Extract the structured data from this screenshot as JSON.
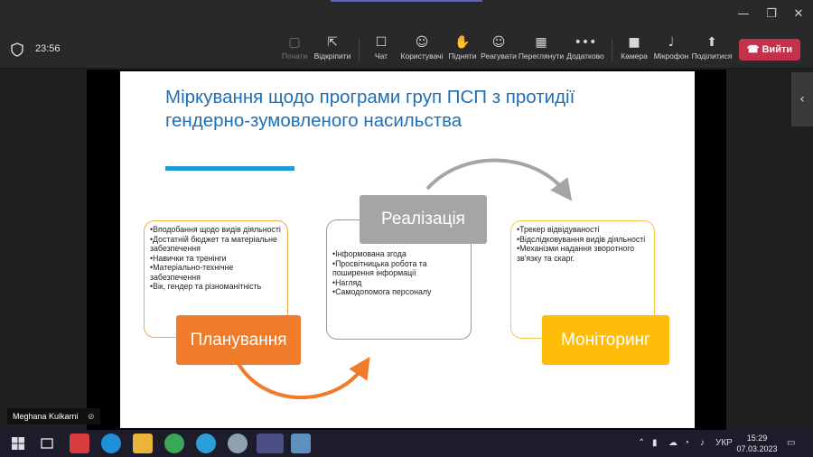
{
  "window": {
    "controls": [
      "—",
      "❐",
      "✕"
    ]
  },
  "toolbar": {
    "timer": "23:56",
    "buttons": [
      {
        "label": "Почати",
        "icon": "▢"
      },
      {
        "label": "Відкріпити",
        "icon": "⇱"
      },
      {
        "label": "Чат",
        "icon": "☐"
      },
      {
        "label": "Користувачі",
        "icon": "☺"
      },
      {
        "label": "Підняти",
        "icon": "✋"
      },
      {
        "label": "Реагувати",
        "icon": "☺"
      },
      {
        "label": "Переглянути",
        "icon": "▦"
      },
      {
        "label": "Додатково",
        "icon": "•••"
      },
      {
        "label": "Камера",
        "icon": "■"
      },
      {
        "label": "Мікрофон",
        "icon": "♩"
      },
      {
        "label": "Поділитися",
        "icon": "⬆"
      }
    ],
    "leave_label": "Вийти",
    "leave_icon": "☎"
  },
  "slide": {
    "title": "Міркування щодо програми груп ПСП з протидії гендерно-зумовленого насильства",
    "planning": {
      "label": "Планування",
      "items": [
        "•Вподобання щодо видів діяльності",
        "•Достатній бюджет та матеріальне забезпечення",
        "•Навички та тренінги",
        "•Матеріально-технічне забезпечення",
        "•Вік, гендер та різноманітність"
      ]
    },
    "implementation": {
      "label": "Реалізація",
      "items": [
        "•Інформована згода",
        "•Просвітницька робота та поширення інформації",
        "•Нагляд",
        "•Самодопомога персоналу"
      ]
    },
    "monitoring": {
      "label": "Моніторинг",
      "items": [
        "•Трекер відвідуваності",
        "•Відслідковування видів діяльності",
        "•Механізми надання зворотного зв'язку та скарг."
      ]
    },
    "colors": {
      "planning": "#f07b2b",
      "implementation": "#a5a5a5",
      "monitoring": "#ffbd0a",
      "title": "#1f6fb6"
    }
  },
  "participant": {
    "name": "Meghana Kulkarni",
    "mic_icon": "🎙"
  },
  "taskbar": {
    "language": "УКР",
    "time": "15:29",
    "date": "07.03.2023"
  }
}
